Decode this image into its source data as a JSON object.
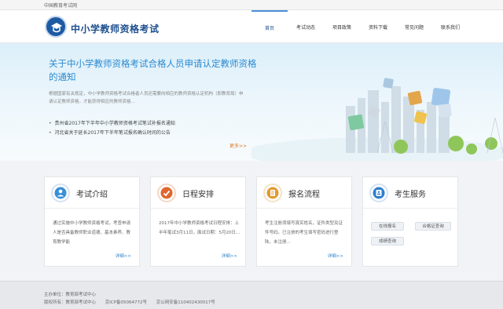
{
  "topbar": {
    "text": "中国教育考试网"
  },
  "header": {
    "site_title": "中小学教师资格考试",
    "nav": [
      {
        "label": "首页"
      },
      {
        "label": "考试动态"
      },
      {
        "label": "项目政策"
      },
      {
        "label": "资料下载"
      },
      {
        "label": "常见问题"
      },
      {
        "label": "联系我们"
      }
    ]
  },
  "hero": {
    "title": "关于中小学教师资格考试合格人员申请认定教师资格的通知",
    "description": "根据国家有关规定，中小学教师资格考试合格者人员还需要向相应的教师资格认定机构（即教育局）申请认定教师资格，才能获得相应的教师资格...",
    "list": [
      "贵州省2017年下半年中小学教师资格考试笔试补报名通知",
      "河北省关于延长2017年下半年笔试报名确认时间的公告"
    ],
    "more": "更多>>"
  },
  "cards": [
    {
      "title": "考试介绍",
      "body": "通过实施中小学教师资格考试，考查申请人是否具备教师职业道德、基本素养、教育教学能",
      "more": "详细>>"
    },
    {
      "title": "日程安排",
      "body": "2017年中小学教师资格考试日程安排：上半年笔试3月11日，面试日期：5月20日...",
      "more": "详细>>"
    },
    {
      "title": "报名流程",
      "body": "考生注册须填写真实姓名，证件类型及证件号码。已注册的考生填写密码进行登陆，未注册...",
      "more": "详细>>"
    },
    {
      "title": "考生服务",
      "buttons": [
        "在线报名",
        "合格证查询",
        "成绩查询"
      ]
    }
  ],
  "footer": {
    "line1": [
      "主办单位：教育部考试中心"
    ],
    "line2": [
      "版权所有：教育部考试中心",
      "京ICP备05064772号",
      "京公网安备110402430017号"
    ]
  },
  "colors": {
    "brand": "#1d4f8f",
    "accent": "#2a8ad0",
    "more": "#e07a20"
  }
}
